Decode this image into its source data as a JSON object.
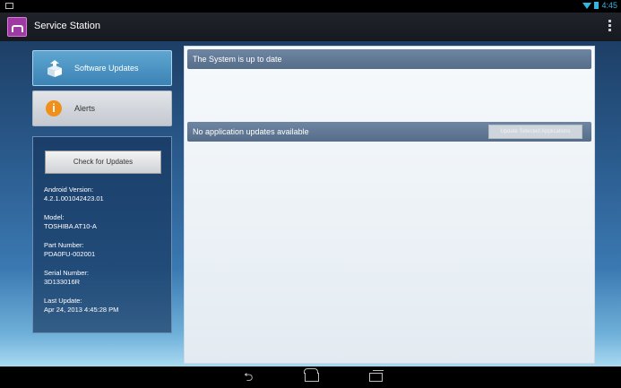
{
  "status_bar": {
    "time": "4:45",
    "icons": [
      "notification-icon",
      "wifi-icon",
      "battery-icon"
    ]
  },
  "app": {
    "title": "Service Station",
    "icon": "service-station-icon"
  },
  "sidebar": {
    "buttons": [
      {
        "label": "Software Updates",
        "icon": "package-icon",
        "selected": true
      },
      {
        "label": "Alerts",
        "icon": "info-alert-icon",
        "selected": false
      }
    ],
    "check_button": "Check for Updates",
    "info": [
      {
        "label": "Android Version:",
        "value": "4.2.1.001042423.01"
      },
      {
        "label": "Model:",
        "value": "TOSHIBA AT10-A"
      },
      {
        "label": "Part Number:",
        "value": "PDA0FU-002001"
      },
      {
        "label": "Serial Number:",
        "value": "3D133016R"
      },
      {
        "label": "Last Update:",
        "value": "Apr 24, 2013 4:45:28 PM"
      }
    ]
  },
  "main": {
    "system_status": "The System is up to date",
    "app_status": "No application updates available",
    "update_button": "Update Selected Applications"
  },
  "colors": {
    "accent": "#33b5e5",
    "selected_button": "#4a93c4",
    "section_bar": "#627a98",
    "alert_orange": "#f0901b"
  }
}
